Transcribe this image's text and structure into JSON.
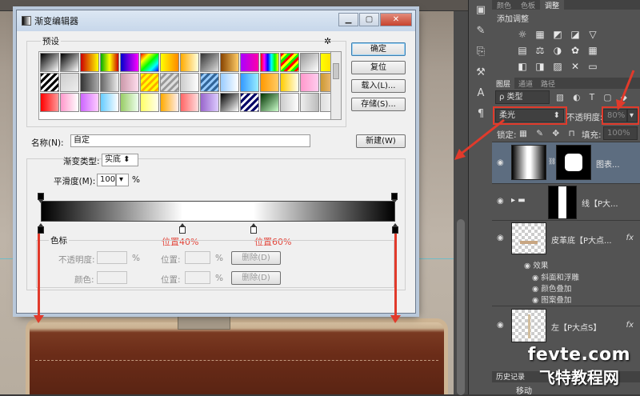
{
  "dialog": {
    "title": "渐变编辑器",
    "presets_label": "预设",
    "gear_glyph": "✲",
    "buttons": {
      "ok": "确定",
      "reset": "复位",
      "load": "载入(L)...",
      "save": "存储(S)...",
      "new": "新建(W)"
    },
    "name_label": "名称(N):",
    "name_value": "自定",
    "gradient_type_label": "渐变类型:",
    "gradient_type_value": "实底",
    "smoothness_label": "平滑度(M):",
    "smoothness_value": "100",
    "smoothness_unit": "%",
    "stops_label": "色标",
    "opacity_label": "不透明度:",
    "opacity_unit": "%",
    "location_label": "位置:",
    "location_unit": "%",
    "delete_label": "删除(D)",
    "color_label": "颜色:"
  },
  "annotations": {
    "left": "位置40%",
    "right": "位置60%"
  },
  "gradient_stops": [
    0,
    40,
    60,
    100
  ],
  "ps_panel": {
    "top_tabs": [
      "颜色",
      "色板",
      "调整"
    ],
    "adjust_title": "添加调整",
    "adjust_row1": [
      "☼",
      "▦",
      "◩",
      "◪",
      "▽"
    ],
    "adjust_row2": [
      "▤",
      "⚖",
      "◑",
      "✿",
      "▦"
    ],
    "adjust_row3": [
      "◧",
      "◨",
      "▨",
      "✕",
      "▭"
    ],
    "layer_tabs": [
      "图层",
      "通道",
      "路径"
    ],
    "kind_label": "ρ 类型",
    "blend_mode": "柔光",
    "opacity_label": "不透明度:",
    "opacity_value": "80%",
    "lock_label": "锁定:",
    "fill_label": "填充:",
    "fill_value": "100%",
    "layers": [
      {
        "name": "图表..."
      },
      {
        "name": "线【P大..."
      },
      {
        "name": "皮革底【P大点..."
      },
      {
        "name": "左【P大点S】"
      }
    ],
    "effects": [
      "效果",
      "斜面和浮雕",
      "颜色叠加",
      "图案叠加"
    ],
    "history_label": "历史记录",
    "history_item": "移动"
  },
  "watermark": {
    "line1": "fevte.com",
    "line2": "飞特教程网"
  },
  "colors": {
    "annotation": "#e2453a",
    "arrow": "#e13a2b",
    "selected_layer": "#5d6d80"
  }
}
